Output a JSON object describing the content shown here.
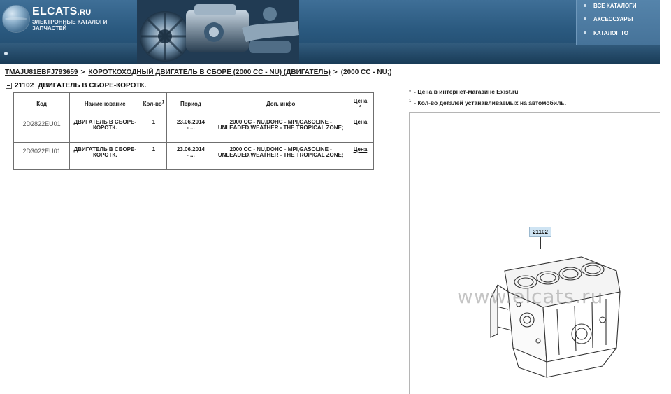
{
  "header": {
    "logo_title": "ELCATS",
    "logo_suffix": ".RU",
    "logo_subtitle": "ЭЛЕКТРОННЫЕ КАТАЛОГИ ЗАПЧАСТЕЙ",
    "nav": [
      {
        "label": "ВСЕ КАТАЛОГИ"
      },
      {
        "label": "АКСЕССУАРЫ"
      },
      {
        "label": "КАТАЛОГ ТО"
      }
    ]
  },
  "breadcrumb": {
    "vin": "TMAJU81EBFJ793659",
    "section": "КОРОТКОХОДНЫЙ ДВИГАТЕЛЬ В СБОРЕ (2000 CC - NU) (ДВИГАТЕЛЬ)",
    "current": "(2000 CC - NU;)"
  },
  "group": {
    "code": "21102",
    "title": "ДВИГАТЕЛЬ В СБОРЕ-КОРОТК."
  },
  "table": {
    "headers": {
      "code": "Код",
      "name": "Наименование",
      "qty": "Кол-во",
      "qty_mark": "1",
      "period": "Период",
      "info": "Доп. инфо",
      "price": "Цена",
      "price_mark": "*"
    },
    "rows": [
      {
        "code": "2D2822EU01",
        "name": "ДВИГАТЕЛЬ В СБОРЕ-КОРОТК.",
        "qty": "1",
        "period": "23.06.2014",
        "period_more": "- ...",
        "info": "2000 CC - NU,DOHC - MPI,GASOLINE - UNLEADED,WEATHER - THE TROPICAL ZONE;",
        "price": "Цена"
      },
      {
        "code": "2D3022EU01",
        "name": "ДВИГАТЕЛЬ В СБОРЕ-КОРОТК.",
        "qty": "1",
        "period": "23.06.2014",
        "period_more": "- ...",
        "info": "2000 CC - NU,DOHC - MPI,GASOLINE - UNLEADED,WEATHER - THE TROPICAL ZONE;",
        "price": "Цена"
      }
    ]
  },
  "notes": {
    "price_mark": "*",
    "price_text": "- Цена в интернет-магазине Exist.ru",
    "qty_mark": "1",
    "qty_text": "- Кол-во деталей устанавливаемых на автомобиль."
  },
  "diagram": {
    "callout": "21102",
    "watermark": "www.elcats.ru"
  },
  "colors": {
    "header_bg": "#2b5a80",
    "nav_bg": "#467399",
    "callout_bg": "#cfe4f3"
  }
}
